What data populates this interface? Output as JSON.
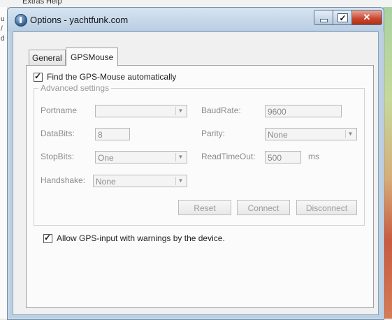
{
  "background_app": {
    "menu": [
      "Extras",
      "Help"
    ],
    "left_letters": [
      "u",
      "/",
      "d"
    ]
  },
  "window": {
    "title": "Options - yachtfunk.com",
    "tabs": [
      {
        "label": "General",
        "active": false
      },
      {
        "label": "GPSMouse",
        "active": true
      }
    ]
  },
  "gps": {
    "auto_find": {
      "label": "Find the GPS-Mouse automatically",
      "checked": true
    },
    "advanced": {
      "legend": "Advanced settings",
      "portname": {
        "label": "Portname",
        "value": ""
      },
      "baudrate": {
        "label": "BaudRate:",
        "value": "9600"
      },
      "databits": {
        "label": "DataBits:",
        "value": "8"
      },
      "parity": {
        "label": "Parity:",
        "value": "None"
      },
      "stopbits": {
        "label": "StopBits:",
        "value": "One"
      },
      "readtimeout": {
        "label": "ReadTimeOut:",
        "value": "500",
        "unit": "ms"
      },
      "handshake": {
        "label": "Handshake:",
        "value": "None"
      },
      "buttons": {
        "reset": "Reset",
        "connect": "Connect",
        "disconnect": "Disconnect"
      }
    },
    "allow_warnings": {
      "label": "Allow GPS-input with warnings by the device.",
      "checked": true
    }
  },
  "icons": {
    "app": "app-icon",
    "minimize": "minimize-icon",
    "maximize": "maximize-icon",
    "close": "close-icon",
    "dropdown": "chevron-down-icon"
  },
  "colors": {
    "titlebar": "#c6d7ea",
    "close_button": "#c9442d",
    "disabled_text": "#8a8a8a"
  }
}
